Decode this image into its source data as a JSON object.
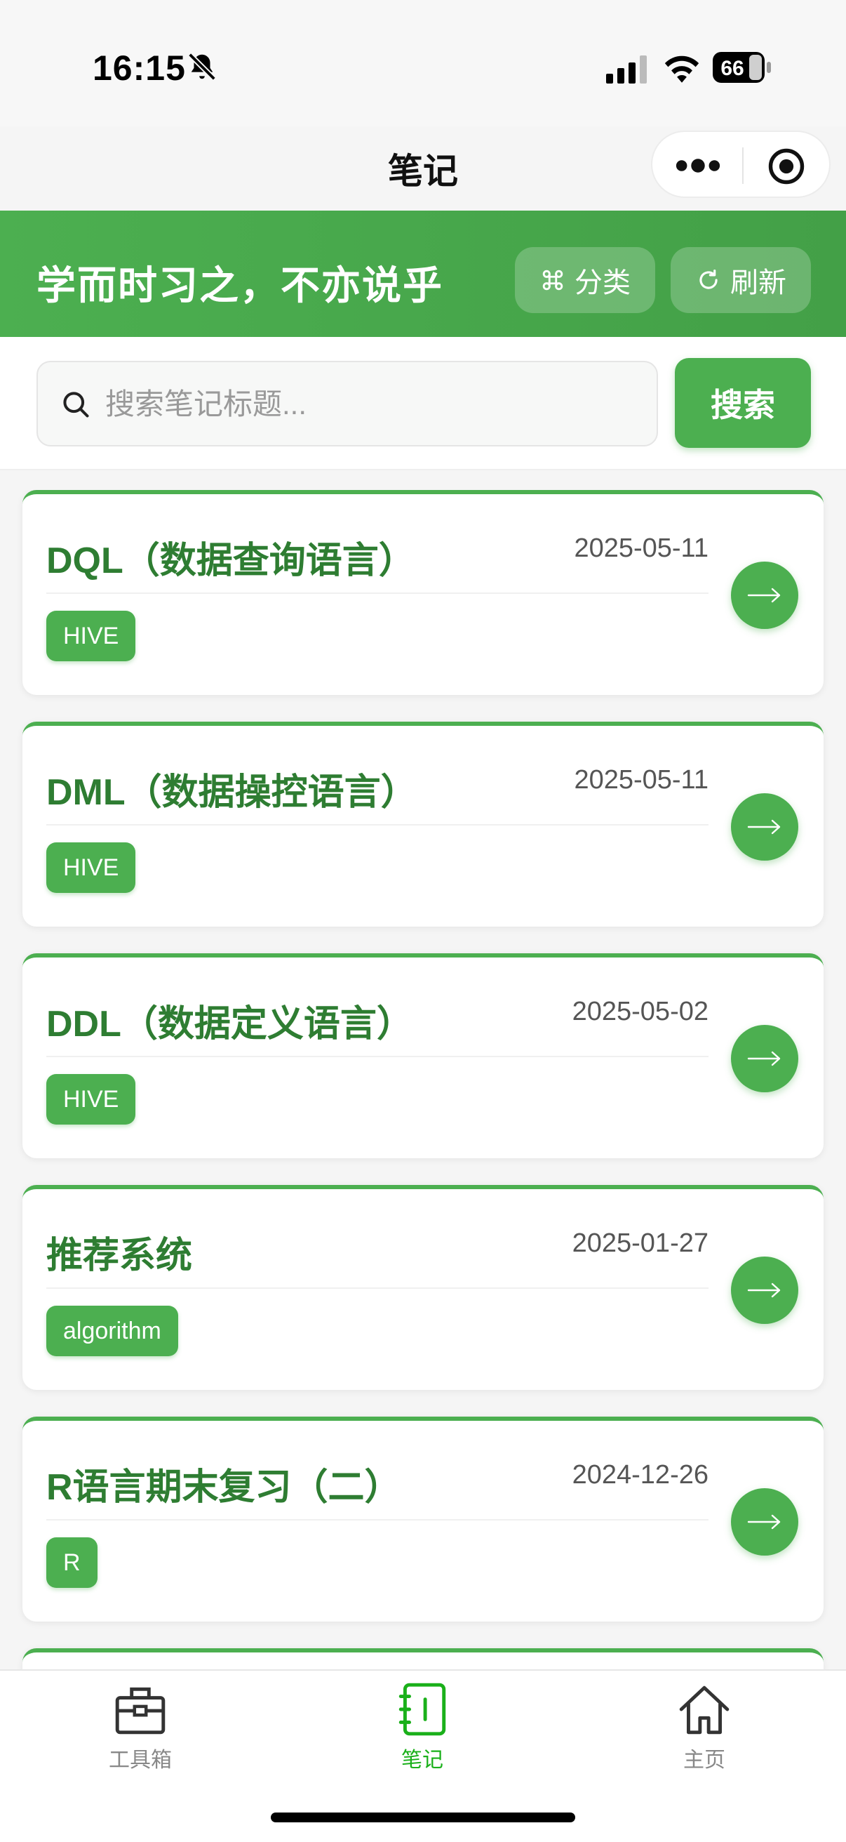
{
  "status_bar": {
    "time": "16:15",
    "battery": "66"
  },
  "nav": {
    "title": "笔记"
  },
  "banner": {
    "motto": "学而时习之，不亦说乎",
    "category_label": "分类",
    "refresh_label": "刷新"
  },
  "search": {
    "placeholder": "搜索笔记标题...",
    "value": "",
    "button_label": "搜索"
  },
  "notes": [
    {
      "title": "DQL（数据查询语言）",
      "date": "2025-05-11",
      "tag": "HIVE"
    },
    {
      "title": "DML（数据操控语言）",
      "date": "2025-05-11",
      "tag": "HIVE"
    },
    {
      "title": "DDL（数据定义语言）",
      "date": "2025-05-02",
      "tag": "HIVE"
    },
    {
      "title": "推荐系统",
      "date": "2025-01-27",
      "tag": "algorithm"
    },
    {
      "title": "R语言期末复习（二）",
      "date": "2024-12-26",
      "tag": "R"
    }
  ],
  "tabbar": {
    "items": [
      {
        "label": "工具箱",
        "icon": "toolbox-icon"
      },
      {
        "label": "笔记",
        "icon": "notebook-icon",
        "active": true
      },
      {
        "label": "主页",
        "icon": "home-icon"
      }
    ]
  },
  "colors": {
    "primary": "#4caf50",
    "title_green": "#2e7d32",
    "active_tab": "#1ab01a"
  }
}
